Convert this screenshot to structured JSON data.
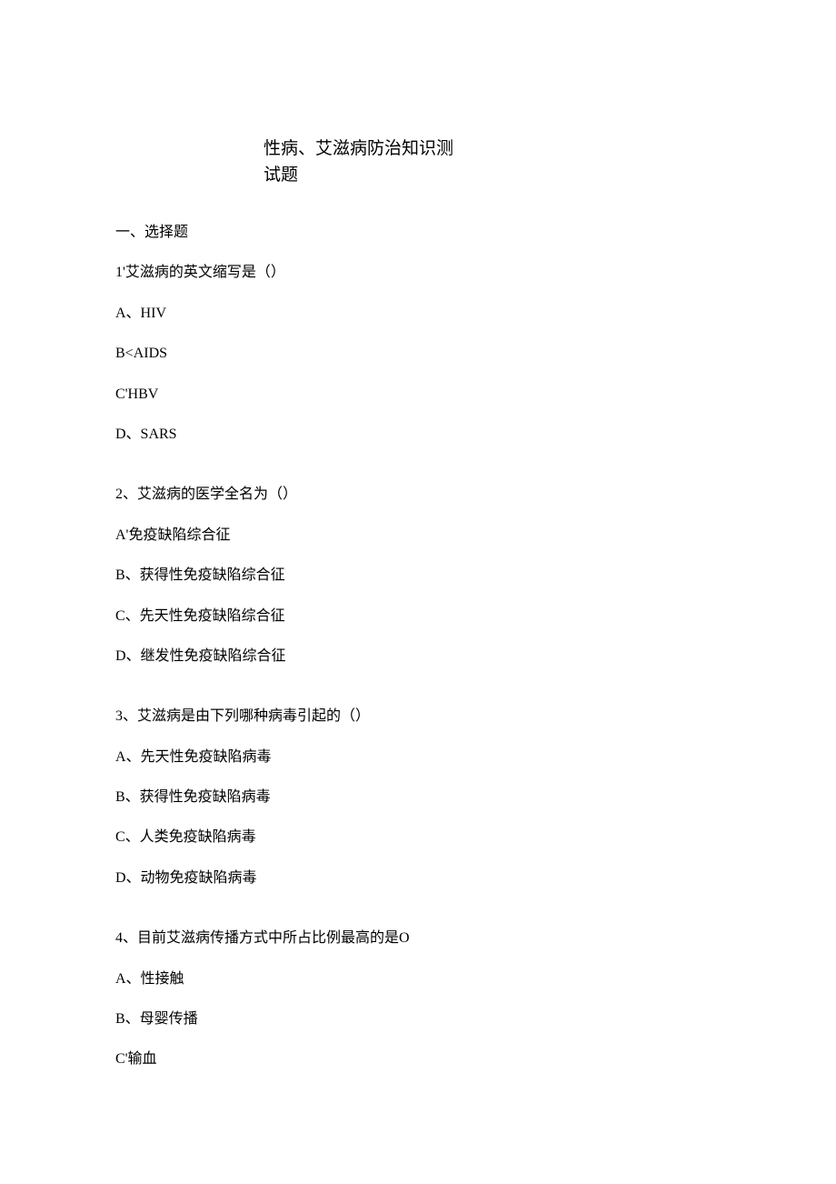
{
  "title_line1": "性病、艾滋病防治知识测",
  "title_line2": "试题",
  "section_header": "一、选择题",
  "q1": {
    "text": "1'艾滋病的英文缩写是（）",
    "a": "A、HIV",
    "b": "B<AIDS",
    "c": "C'HBV",
    "d": "D、SARS"
  },
  "q2": {
    "text": "2、艾滋病的医学全名为（）",
    "a": "A'免疫缺陷综合征",
    "b": "B、获得性免疫缺陷综合征",
    "c": "C、先天性免疫缺陷综合征",
    "d": "D、继发性免疫缺陷综合征"
  },
  "q3": {
    "text": "3、艾滋病是由下列哪种病毒引起的（）",
    "a": "A、先天性免疫缺陷病毒",
    "b": "B、获得性免疫缺陷病毒",
    "c": "C、人类免疫缺陷病毒",
    "d": "D、动物免疫缺陷病毒"
  },
  "q4": {
    "text": "4、目前艾滋病传播方式中所占比例最高的是O",
    "a": "A、性接触",
    "b": "B、母婴传播",
    "c": "C'输血"
  }
}
